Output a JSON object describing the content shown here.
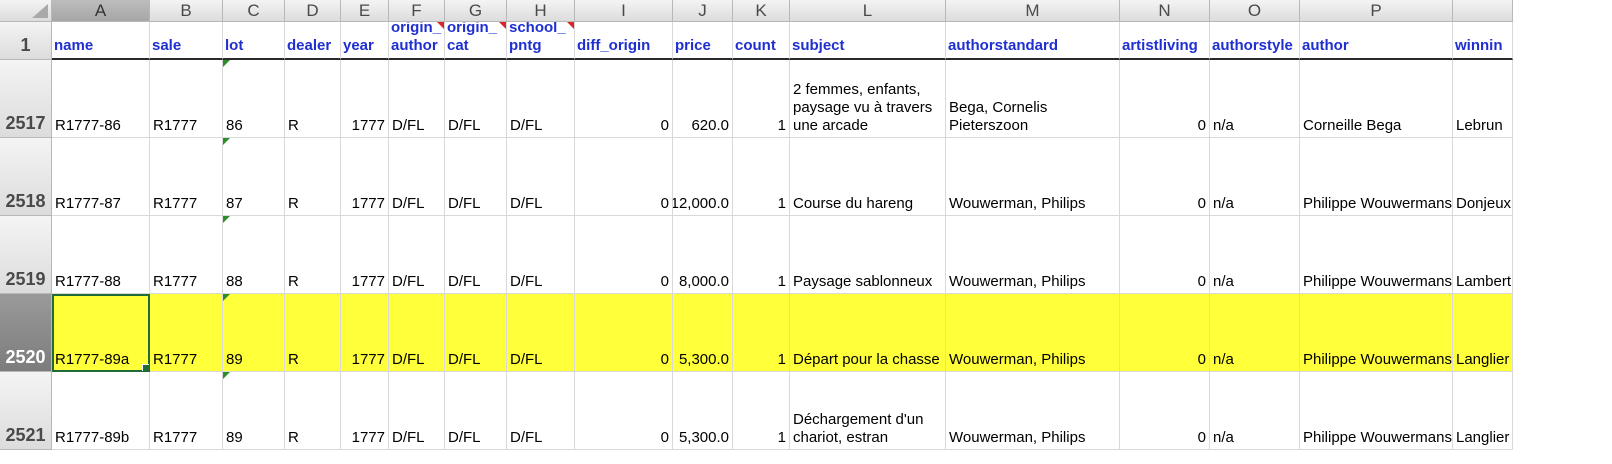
{
  "columns": [
    "A",
    "B",
    "C",
    "D",
    "E",
    "F",
    "G",
    "H",
    "I",
    "J",
    "K",
    "L",
    "M",
    "N",
    "O",
    "P",
    ""
  ],
  "selected_column": "A",
  "header_row": {
    "number": "1",
    "cells": [
      "name",
      "sale",
      "lot",
      "dealer",
      "year",
      "origin_ author",
      "origin_ cat",
      "school_ pntg",
      "diff_origin",
      "price",
      "count",
      "subject",
      "authorstandard",
      "artistliving",
      "authorstyle",
      "author",
      "winnin"
    ]
  },
  "rows": [
    {
      "number": "2517",
      "cells": [
        "R1777-86",
        "R1777",
        "86",
        "R",
        "1777",
        "D/FL",
        "D/FL",
        "D/FL",
        "0",
        "620.0",
        "1",
        "2 femmes, enfants, paysage vu à travers une arcade",
        "Bega, Cornelis Pieterszoon",
        "0",
        "n/a",
        "Corneille Bega",
        "Lebrun"
      ]
    },
    {
      "number": "2518",
      "cells": [
        "R1777-87",
        "R1777",
        "87",
        "R",
        "1777",
        "D/FL",
        "D/FL",
        "D/FL",
        "0",
        "12,000.0",
        "1",
        "Course du hareng",
        "Wouwerman, Philips",
        "0",
        "n/a",
        "Philippe Wouwermans",
        "Donjeux"
      ]
    },
    {
      "number": "2519",
      "cells": [
        "R1777-88",
        "R1777",
        "88",
        "R",
        "1777",
        "D/FL",
        "D/FL",
        "D/FL",
        "0",
        "8,000.0",
        "1",
        "Paysage sablonneux",
        "Wouwerman, Philips",
        "0",
        "n/a",
        "Philippe Wouwermans",
        "Lambert"
      ]
    },
    {
      "number": "2520",
      "cells": [
        "R1777-89a",
        "R1777",
        "89",
        "R",
        "1777",
        "D/FL",
        "D/FL",
        "D/FL",
        "0",
        "5,300.0",
        "1",
        "Départ pour la chasse",
        "Wouwerman, Philips",
        "0",
        "n/a",
        "Philippe Wouwermans",
        "Langlier"
      ]
    },
    {
      "number": "2521",
      "cells": [
        "R1777-89b",
        "R1777",
        "89",
        "R",
        "1777",
        "D/FL",
        "D/FL",
        "D/FL",
        "0",
        "5,300.0",
        "1",
        "Déchargement d'un chariot, estran",
        "Wouwerman, Philips",
        "0",
        "n/a",
        "Philippe Wouwermans",
        "Langlier"
      ]
    }
  ],
  "highlighted_row": "2520",
  "active_cell": "A2520",
  "colors": {
    "highlight": "#ffff3a",
    "header_text": "#1f2fd0",
    "active_border": "#1f6b3a",
    "comment_flag": "#d8262b",
    "note_flag": "#2e8b2e"
  }
}
